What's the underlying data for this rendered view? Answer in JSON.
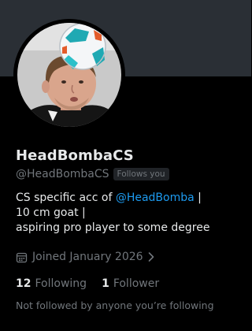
{
  "profile": {
    "display_name": "HeadBombaCS",
    "handle": "@HeadBombaCS",
    "follows_you_badge": "Follows you",
    "avatar_description": "profile photo: person with a soccer ball on his head"
  },
  "bio": {
    "line1_prefix": "CS specific acc of ",
    "line1_mention": "@HeadBomba",
    "line1_suffix": " |",
    "line2": "10 cm goat |",
    "line3": "aspiring pro player to some degree"
  },
  "joined": {
    "text": "Joined January 2026",
    "icon": "calendar-icon"
  },
  "stats": {
    "following_count": "12",
    "following_label": "Following",
    "followers_count": "1",
    "followers_label": "Follower"
  },
  "followers_you_know": {
    "text": "Not followed by anyone you’re following"
  },
  "colors": {
    "background": "#000000",
    "banner": "#2a2f35",
    "primary_text": "#e7e9ea",
    "secondary_text": "#71767b",
    "accent": "#1d9bf0"
  }
}
